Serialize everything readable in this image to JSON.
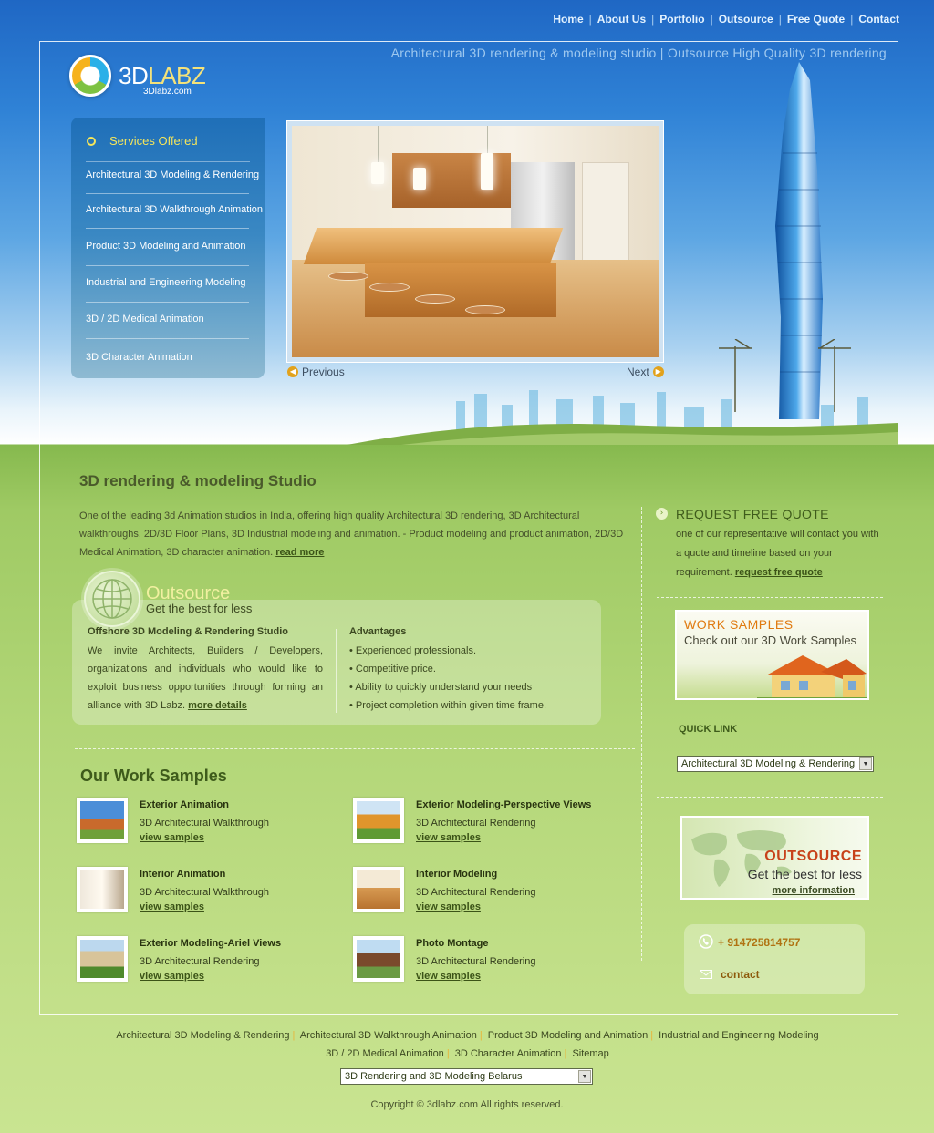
{
  "nav": {
    "items": [
      "Home",
      "About Us",
      "Portfolio",
      "Outsource",
      "Free Quote",
      "Contact"
    ],
    "separator": "|"
  },
  "header": {
    "tagline": "Architectural 3D rendering & modeling studio | Outsource High Quality 3D rendering",
    "logo_text_a": "3D",
    "logo_text_b": "LABZ",
    "logo_sub": "3Dlabz.com"
  },
  "services": {
    "title": "Services Offered",
    "items": [
      "Architectural 3D Modeling & Rendering",
      "Architectural 3D Walkthrough Animation",
      "Product 3D Modeling and Animation",
      "Industrial and Engineering Modeling",
      "3D / 2D Medical Animation",
      "3D Character Animation"
    ]
  },
  "slideshow": {
    "prev_label": "Previous",
    "next_label": "Next"
  },
  "main": {
    "title": "3D rendering & modeling Studio",
    "intro": "One of the leading 3d Animation studios in India, offering high quality Architectural 3D rendering, 3D Architectural walkthroughs, 2D/3D Floor Plans, 3D Industrial modeling and animation. - Product modeling and product animation, 2D/3D Medical Animation, 3D character animation.",
    "read_more": "read more"
  },
  "outsource": {
    "heading": "Outsource",
    "subheading": "Get the best for less",
    "offshore_title": "Offshore 3D Modeling & Rendering Studio",
    "offshore_body": "We invite Architects, Builders / Developers, organizations and individuals who would like to exploit business opportunities through forming an alliance with 3D Labz.",
    "more_details": "more details",
    "advantages_title": "Advantages",
    "advantages": [
      "Experienced professionals.",
      "Competitive price.",
      "Ability to quickly understand your needs",
      "Project completion within given time frame."
    ]
  },
  "samples": {
    "title": "Our Work Samples",
    "link_label": "view samples",
    "items": [
      {
        "title": "Exterior Animation",
        "sub": "3D Architectural Walkthrough"
      },
      {
        "title": "Exterior Modeling-Perspective Views",
        "sub": "3D Architectural Rendering"
      },
      {
        "title": "Interior Animation",
        "sub": "3D Architectural Walkthrough"
      },
      {
        "title": "Interior Modeling",
        "sub": "3D Architectural Rendering"
      },
      {
        "title": "Exterior Modeling-Ariel Views",
        "sub": "3D Architectural Rendering"
      },
      {
        "title": "Photo Montage",
        "sub": "3D Architectural Rendering"
      }
    ]
  },
  "sidebar": {
    "quote_title": "REQUEST FREE QUOTE",
    "quote_body": "one of our representative will contact you with a quote and timeline based on your requirement.",
    "quote_link": "request free quote",
    "work_samples_head": "WORK SAMPLES",
    "work_samples_sub": "Check out our 3D Work Samples",
    "quick_link_label": "QUICK LINK",
    "quick_link_selected": "Architectural 3D Modeling & Rendering",
    "outsource_head": "OUTSOURCE",
    "outsource_sub": "Get the best for less",
    "outsource_link": "more information",
    "phone": "+ 914725814757",
    "contact": "contact"
  },
  "footer": {
    "links": [
      "Architectural 3D Modeling & Rendering",
      "Architectural 3D Walkthrough Animation",
      "Product 3D Modeling and Animation",
      "Industrial and Engineering Modeling",
      "3D / 2D Medical Animation",
      "3D Character Animation",
      "Sitemap"
    ],
    "select_value": "3D Rendering and 3D Modeling Belarus",
    "copyright": "Copyright © 3dlabz.com All rights reserved."
  },
  "colors": {
    "sky_top": "#1f67c4",
    "grass": "#9fca64",
    "accent_yellow": "#f6e65a",
    "accent_orange": "#e07a10"
  }
}
